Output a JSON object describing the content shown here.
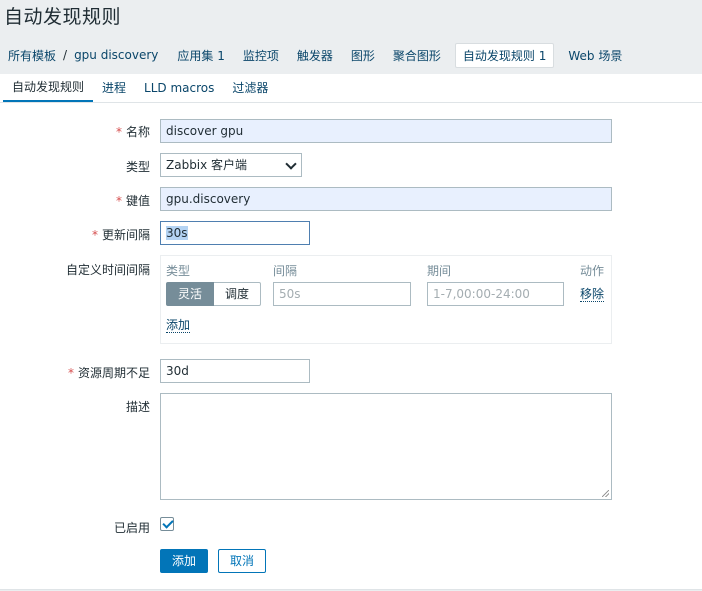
{
  "page_title": "自动发现规则",
  "breadcrumbs": {
    "all_templates": "所有模板",
    "separator": "/",
    "template": "gpu discovery"
  },
  "nav": [
    {
      "label": "应用集 1"
    },
    {
      "label": "监控项"
    },
    {
      "label": "触发器"
    },
    {
      "label": "图形"
    },
    {
      "label": "聚合图形"
    },
    {
      "label": "自动发现规则 1",
      "active": true
    },
    {
      "label": "Web 场景"
    }
  ],
  "tabs": [
    {
      "label": "自动发现规则",
      "active": true
    },
    {
      "label": "进程"
    },
    {
      "label": "LLD macros"
    },
    {
      "label": "过滤器"
    }
  ],
  "form": {
    "name": {
      "label": "名称",
      "required": true,
      "value": "discover gpu"
    },
    "type": {
      "label": "类型",
      "value": "Zabbix 客户端"
    },
    "key": {
      "label": "键值",
      "required": true,
      "value": "gpu.discovery"
    },
    "update_interval": {
      "label": "更新间隔",
      "required": true,
      "value": "30s"
    },
    "custom_intervals": {
      "label": "自定义时间间隔",
      "headers": {
        "type": "类型",
        "interval": "间隔",
        "period": "期间",
        "action": "动作"
      },
      "mode_flexible": "灵活",
      "mode_scheduling": "调度",
      "interval_placeholder": "50s",
      "period_placeholder": "1-7,00:00-24:00",
      "remove": "移除",
      "add": "添加"
    },
    "keep_lost": {
      "label": "资源周期不足",
      "required": true,
      "value": "30d"
    },
    "description": {
      "label": "描述",
      "value": ""
    },
    "enabled": {
      "label": "已启用",
      "checked": true
    },
    "required_marker": "*"
  },
  "buttons": {
    "add": "添加",
    "cancel": "取消"
  },
  "colors": {
    "accent": "#0275b8",
    "link": "#0a466a",
    "required": "#d64e4e",
    "filled_bg": "#e8f0fe"
  }
}
